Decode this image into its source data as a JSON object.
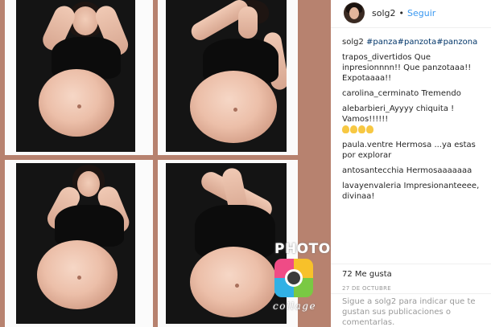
{
  "post": {
    "username": "solg2",
    "separator": "•",
    "follow_label": "Seguir"
  },
  "watermark": {
    "title": "PHOTO",
    "subtitle": "collage"
  },
  "comments": [
    {
      "user": "solg2",
      "text": "",
      "tags": [
        "#panza",
        "#panzota",
        "#panzona"
      ]
    },
    {
      "user": "trapos_divertidos",
      "text": "Que inpresionnnn!! Que panzotaaa!! Expotaaaa!!"
    },
    {
      "user": "carolina_cerminato",
      "text": "Tremendo"
    },
    {
      "user": "alebarbieri_",
      "text": "Ayyyy chiquita ! Vamos!!!!!!",
      "emoji_count": 4,
      "emoji_name": "clapping-hands-icon"
    },
    {
      "user": "paula.ventre",
      "text": "Hermosa ...ya estas por explorar"
    },
    {
      "user": "antosantecchia",
      "text": "Hermosaaaaaaa"
    },
    {
      "user": "lavayenvaleria",
      "text": "Impresionanteeee, divinaa!"
    }
  ],
  "likes": "72 Me gusta",
  "date": "27 DE OCTUBRE",
  "footer": "Sigue a solg2 para indicar que te gustan sus publicaciones o comentarlas.",
  "colors": {
    "link": "#3897f0",
    "hashtag": "#003569",
    "muted": "#999999",
    "collage_border": "#b7826f"
  }
}
